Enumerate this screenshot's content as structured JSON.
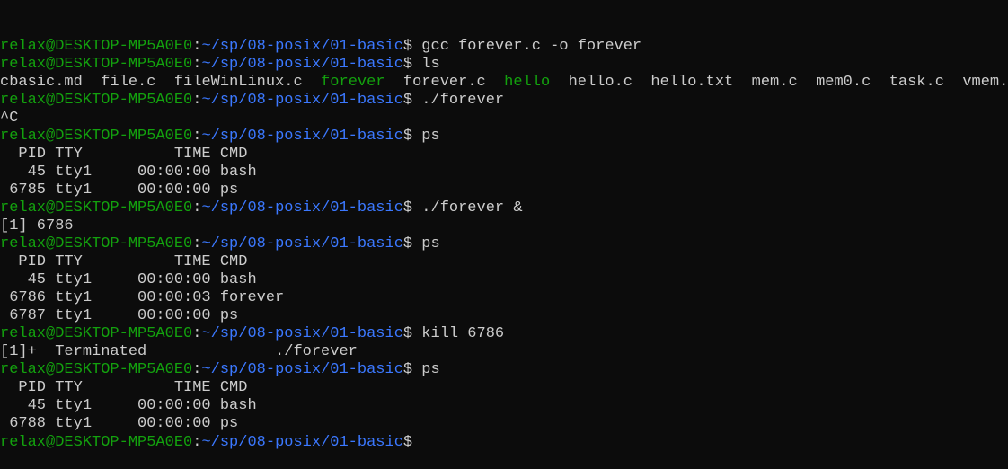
{
  "prompt": {
    "user_host": "relax@DESKTOP-MP5A0E0",
    "sep": ":",
    "path": "~/sp/08-posix/01-basic",
    "symbol": "$ "
  },
  "colors": {
    "background": "#0c0c0c",
    "text": "#cccccc",
    "prompt_user": "#13a10e",
    "prompt_path": "#3b78ff",
    "executable": "#13a10e"
  },
  "lines": [
    {
      "type": "prompt",
      "cmd": "gcc forever.c -o forever"
    },
    {
      "type": "prompt",
      "cmd": "ls"
    },
    {
      "type": "ls",
      "items": [
        {
          "name": "cbasic.md",
          "exec": false
        },
        {
          "name": "file.c",
          "exec": false
        },
        {
          "name": "fileWinLinux.c",
          "exec": false
        },
        {
          "name": "forever",
          "exec": true
        },
        {
          "name": "forever.c",
          "exec": false
        },
        {
          "name": "hello",
          "exec": true
        },
        {
          "name": "hello.c",
          "exec": false
        },
        {
          "name": "hello.txt",
          "exec": false
        },
        {
          "name": "mem.c",
          "exec": false
        },
        {
          "name": "mem0.c",
          "exec": false
        },
        {
          "name": "task.c",
          "exec": false
        },
        {
          "name": "vmem.c",
          "exec": false
        }
      ]
    },
    {
      "type": "prompt",
      "cmd": "./forever"
    },
    {
      "type": "output",
      "text": "^C"
    },
    {
      "type": "prompt",
      "cmd": "ps"
    },
    {
      "type": "output",
      "text": "  PID TTY          TIME CMD"
    },
    {
      "type": "output",
      "text": "   45 tty1     00:00:00 bash"
    },
    {
      "type": "output",
      "text": " 6785 tty1     00:00:00 ps"
    },
    {
      "type": "prompt",
      "cmd": "./forever &"
    },
    {
      "type": "output",
      "text": "[1] 6786"
    },
    {
      "type": "prompt",
      "cmd": "ps"
    },
    {
      "type": "output",
      "text": "  PID TTY          TIME CMD"
    },
    {
      "type": "output",
      "text": "   45 tty1     00:00:00 bash"
    },
    {
      "type": "output",
      "text": " 6786 tty1     00:00:03 forever"
    },
    {
      "type": "output",
      "text": " 6787 tty1     00:00:00 ps"
    },
    {
      "type": "prompt",
      "cmd": "kill 6786"
    },
    {
      "type": "output",
      "text": "[1]+  Terminated              ./forever"
    },
    {
      "type": "prompt",
      "cmd": "ps"
    },
    {
      "type": "output",
      "text": "  PID TTY          TIME CMD"
    },
    {
      "type": "output",
      "text": "   45 tty1     00:00:00 bash"
    },
    {
      "type": "output",
      "text": " 6788 tty1     00:00:00 ps"
    },
    {
      "type": "prompt",
      "cmd": ""
    }
  ]
}
